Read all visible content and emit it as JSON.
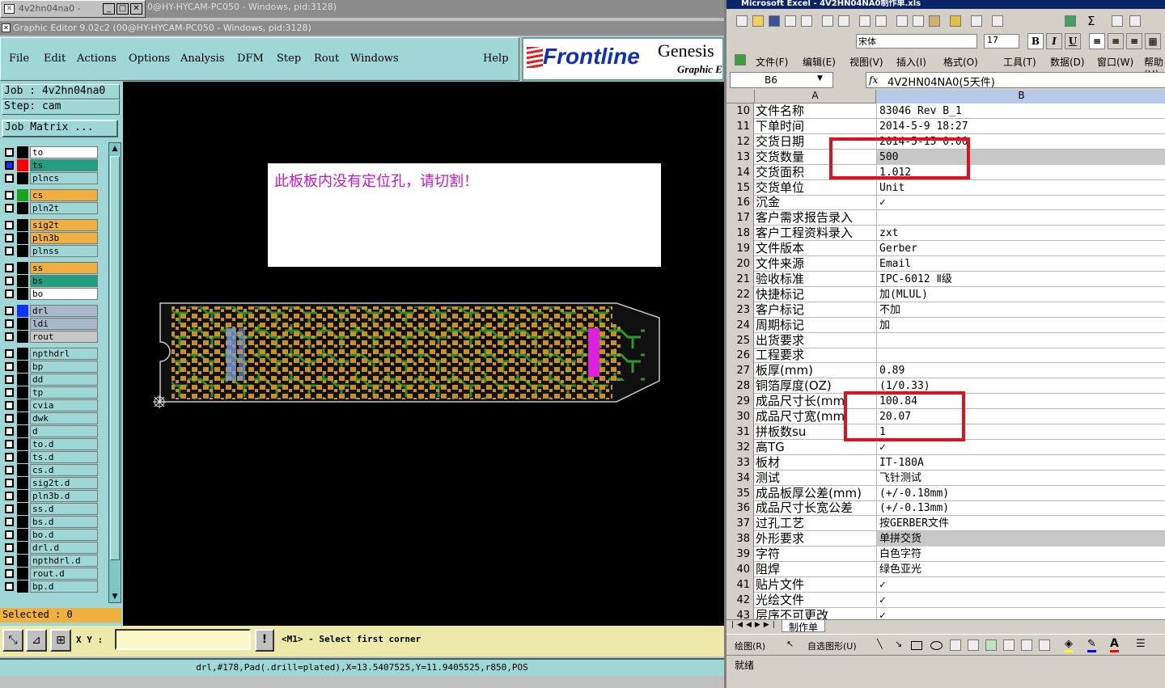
{
  "genesis": {
    "window1_title": "4v2hn04na0 -",
    "window1_subtitle": "0@HY-HYCAM-PC050 - Windows, pid:3128)",
    "window2_title": "Graphic Editor 9.02c2 (00@HY-HYCAM-PC050 - Windows, pid:3128)",
    "menu": [
      "File",
      "Edit",
      "Actions",
      "Options",
      "Analysis",
      "DFM",
      "Step",
      "Rout",
      "Windows",
      "Help"
    ],
    "logo_brand": "Frontline",
    "logo_product": "Genesis",
    "logo_sub": "Graphic E",
    "job_label": "Job : 4v2hn04na0",
    "step_label": "Step: cam",
    "job_matrix_button": "Job Matrix ...",
    "layers": [
      {
        "name": "to",
        "swatch": "#000000",
        "bg": "#ffffff"
      },
      {
        "name": "ts",
        "swatch": "#ff0000",
        "bg": "#20a080",
        "selected": true
      },
      {
        "name": "plncs",
        "swatch": "#000000",
        "bg": "#9fd6d6"
      },
      {
        "name": "cs",
        "swatch": "#20a020",
        "bg": "#f0b040"
      },
      {
        "name": "pln2t",
        "swatch": "#000000",
        "bg": "#9fd6d6"
      },
      {
        "name": "sig2t",
        "swatch": "#000000",
        "bg": "#f0b040"
      },
      {
        "name": "pln3b",
        "swatch": "#000000",
        "bg": "#f0b040"
      },
      {
        "name": "plnss",
        "swatch": "#000000",
        "bg": "#9fd6d6"
      },
      {
        "name": "ss",
        "swatch": "#000000",
        "bg": "#f0b040"
      },
      {
        "name": "bs",
        "swatch": "#000000",
        "bg": "#20a080"
      },
      {
        "name": "bo",
        "swatch": "#000000",
        "bg": "#ffffff"
      },
      {
        "name": "drl",
        "swatch": "#1030ff",
        "bg": "#a8b8c8"
      },
      {
        "name": "ldi",
        "swatch": "#000000",
        "bg": "#a8b8c8"
      },
      {
        "name": "rout",
        "swatch": "#000000",
        "bg": "#c8c8c8"
      },
      {
        "name": "npthdrl",
        "swatch": "#000000",
        "bg": "#9fd6d6"
      },
      {
        "name": "bp",
        "swatch": "#000000",
        "bg": "#9fd6d6"
      },
      {
        "name": "dd",
        "swatch": "#000000",
        "bg": "#9fd6d6"
      },
      {
        "name": "tp",
        "swatch": "#000000",
        "bg": "#9fd6d6"
      },
      {
        "name": "cvia",
        "swatch": "#000000",
        "bg": "#9fd6d6"
      },
      {
        "name": "dwk",
        "swatch": "#000000",
        "bg": "#9fd6d6"
      },
      {
        "name": "d",
        "swatch": "#000000",
        "bg": "#9fd6d6"
      },
      {
        "name": "to.d",
        "swatch": "#000000",
        "bg": "#9fd6d6"
      },
      {
        "name": "ts.d",
        "swatch": "#000000",
        "bg": "#9fd6d6"
      },
      {
        "name": "cs.d",
        "swatch": "#000000",
        "bg": "#9fd6d6"
      },
      {
        "name": "sig2t.d",
        "swatch": "#000000",
        "bg": "#9fd6d6"
      },
      {
        "name": "pln3b.d",
        "swatch": "#000000",
        "bg": "#9fd6d6"
      },
      {
        "name": "ss.d",
        "swatch": "#000000",
        "bg": "#9fd6d6"
      },
      {
        "name": "bs.d",
        "swatch": "#000000",
        "bg": "#9fd6d6"
      },
      {
        "name": "bo.d",
        "swatch": "#000000",
        "bg": "#9fd6d6"
      },
      {
        "name": "drl.d",
        "swatch": "#000000",
        "bg": "#9fd6d6"
      },
      {
        "name": "npthdrl.d",
        "swatch": "#000000",
        "bg": "#9fd6d6"
      },
      {
        "name": "rout.d",
        "swatch": "#000000",
        "bg": "#9fd6d6"
      },
      {
        "name": "bp.d",
        "swatch": "#000000",
        "bg": "#9fd6d6"
      }
    ],
    "selected_label": "Selected : 0",
    "canvas_message": "此板板内没有定位孔，请切割！",
    "xy_label": "X Y :",
    "xy_value": "",
    "info_button": "!",
    "hint": "<M1> - Select first corner",
    "status_line": "drl,#178,Pad(.drill=plated),X=13.5407525,Y=11.9405525,r850,POS"
  },
  "excel": {
    "title": "Microsoft Excel - 4V2HN04NA0制作单.xls",
    "font_name": "宋体",
    "font_size": "17",
    "menu": [
      "文件(F)",
      "编辑(E)",
      "视图(V)",
      "插入(I)",
      "格式(O)",
      "工具(T)",
      "数据(D)",
      "窗口(W)",
      "帮助(H)"
    ],
    "name_box": "B6",
    "fx": "fx",
    "formula_value": "4V2HN04NA0(5天件)",
    "columns": [
      "A",
      "B"
    ],
    "rows": [
      {
        "n": "10",
        "a": "文件名称",
        "b": "83046 Rev B_1"
      },
      {
        "n": "11",
        "a": "下单时间",
        "b": "2014-5-9 18:27"
      },
      {
        "n": "12",
        "a": "交货日期",
        "b": "2014-5-15 0:00"
      },
      {
        "n": "13",
        "a": "交货数量",
        "b": "500",
        "shade": true
      },
      {
        "n": "14",
        "a": "交货面积",
        "b": "1.012"
      },
      {
        "n": "15",
        "a": "交货单位",
        "b": "Unit"
      },
      {
        "n": "16",
        "a": "沉金",
        "b": "✓"
      },
      {
        "n": "17",
        "a": "客户需求报告录入",
        "b": ""
      },
      {
        "n": "18",
        "a": "客户工程资料录入",
        "b": "zxt"
      },
      {
        "n": "19",
        "a": "文件版本",
        "b": "Gerber"
      },
      {
        "n": "20",
        "a": "文件来源",
        "b": "Email"
      },
      {
        "n": "21",
        "a": "验收标准",
        "b": "IPC-6012 Ⅱ级"
      },
      {
        "n": "22",
        "a": "快捷标记",
        "b": "加(MLUL)"
      },
      {
        "n": "23",
        "a": "客户标记",
        "b": "不加"
      },
      {
        "n": "24",
        "a": "周期标记",
        "b": "加"
      },
      {
        "n": "25",
        "a": "出货要求",
        "b": ""
      },
      {
        "n": "26",
        "a": "工程要求",
        "b": ""
      },
      {
        "n": "27",
        "a": "板厚(mm)",
        "b": "0.89"
      },
      {
        "n": "28",
        "a": "铜箔厚度(OZ)",
        "b": "(1/0.33)"
      },
      {
        "n": "29",
        "a": "成品尺寸长(mm",
        "b": "100.84"
      },
      {
        "n": "30",
        "a": "成品尺寸宽(mm",
        "b": "20.07"
      },
      {
        "n": "31",
        "a": "拼板数su",
        "b": "1"
      },
      {
        "n": "32",
        "a": "高TG",
        "b": "✓"
      },
      {
        "n": "33",
        "a": "板材",
        "b": "IT-180A"
      },
      {
        "n": "34",
        "a": "测试",
        "b": "飞针测试"
      },
      {
        "n": "35",
        "a": "成品板厚公差(mm)",
        "b": "(+/-0.18mm)"
      },
      {
        "n": "36",
        "a": "成品尺寸长宽公差",
        "b": "(+/-0.13mm)"
      },
      {
        "n": "37",
        "a": "过孔工艺",
        "b": "按GERBER文件"
      },
      {
        "n": "38",
        "a": "外形要求",
        "b": "单拼交货",
        "shade": true
      },
      {
        "n": "39",
        "a": "字符",
        "b": "白色字符"
      },
      {
        "n": "40",
        "a": "阻焊",
        "b": "绿色亚光"
      },
      {
        "n": "41",
        "a": "贴片文件",
        "b": "✓"
      },
      {
        "n": "42",
        "a": "光绘文件",
        "b": "✓"
      },
      {
        "n": "43",
        "a": "层序不可更改",
        "b": "✓"
      }
    ],
    "sheet_tab": "制作单",
    "draw_label": "绘图(R)",
    "autoshape_label": "自选图形(U)",
    "status": "就绪"
  }
}
